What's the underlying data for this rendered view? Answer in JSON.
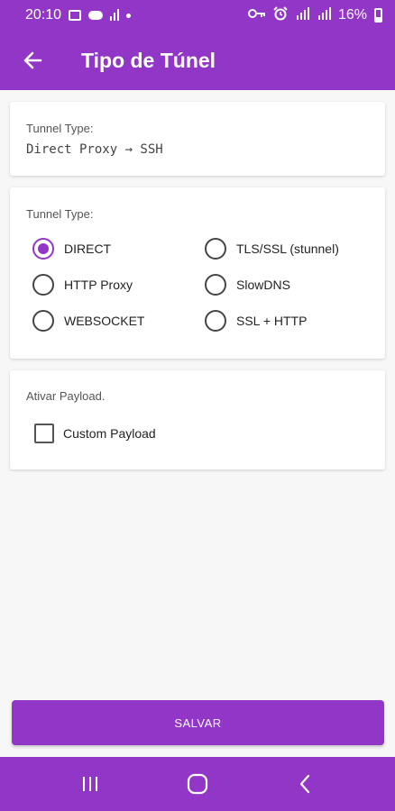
{
  "status_bar": {
    "time": "20:10",
    "battery": "16%"
  },
  "app_bar": {
    "title": "Tipo de Túnel"
  },
  "current_tunnel": {
    "label": "Tunnel Type:",
    "value": "Direct Proxy → SSH"
  },
  "tunnel_options": {
    "label": "Tunnel Type:",
    "selected": "DIRECT",
    "options": [
      "DIRECT",
      "TLS/SSL (stunnel)",
      "HTTP Proxy",
      "SlowDNS",
      "WEBSOCKET",
      "SSL + HTTP"
    ]
  },
  "payload": {
    "label": "Ativar Payload.",
    "checkbox_label": "Custom Payload",
    "checked": false
  },
  "save_label": "SALVAR",
  "colors": {
    "accent": "#9236c8",
    "background": "#f7f7f7"
  },
  "icons": {
    "back": "arrow-left-icon",
    "nav_recents": "recents-icon",
    "nav_home": "home-icon",
    "nav_back": "back-icon"
  }
}
